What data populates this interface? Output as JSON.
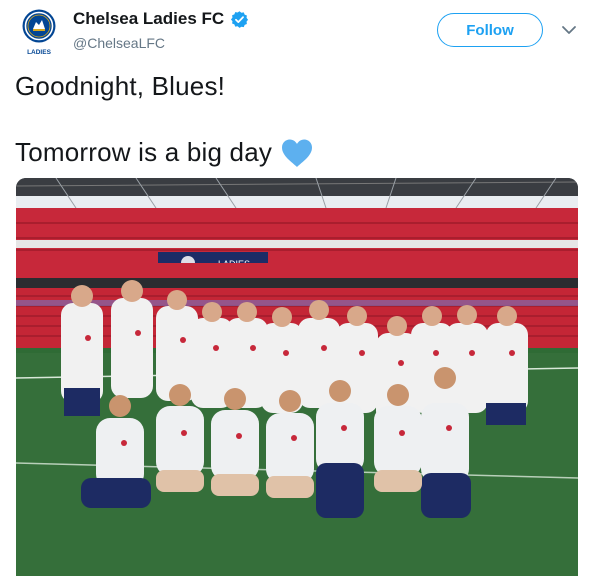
{
  "account": {
    "display_name": "Chelsea Ladies FC",
    "handle": "@ChelseaLFC",
    "avatar_caption": "LADIES",
    "verified": true
  },
  "actions": {
    "follow_label": "Follow"
  },
  "tweet": {
    "line1": "Goodnight, Blues!",
    "line2": "Tomorrow is a big day"
  },
  "photo": {
    "banner_text": "LADIES"
  },
  "colors": {
    "accent": "#1da1f2",
    "heart": "#5db0ef",
    "club_blue": "#034694",
    "text": "#14171a",
    "muted": "#657786"
  },
  "icons": {
    "verified": "verified-badge-icon",
    "caret": "chevron-down-icon",
    "emoji": "blue-heart-emoji"
  }
}
